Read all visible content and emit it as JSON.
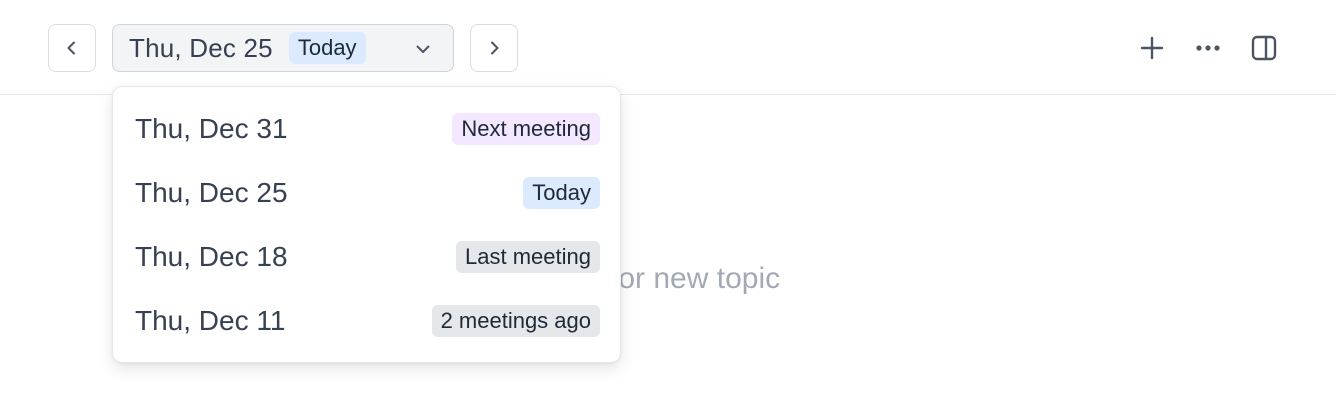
{
  "header": {
    "selected_date": "Thu, Dec 25",
    "selected_badge": "Today",
    "icons": {
      "prev": "chevron-left-icon",
      "next": "chevron-right-icon",
      "dropdown": "chevron-down-icon",
      "add": "plus-icon",
      "more": "more-horizontal-icon",
      "panel": "sidebar-panel-icon"
    }
  },
  "main": {
    "placeholder": "nter” for new topic"
  },
  "dropdown": {
    "items": [
      {
        "label": "Thu, Dec 31",
        "badge": "Next meeting",
        "badge_color": "#f3e8ff"
      },
      {
        "label": "Thu, Dec 25",
        "badge": "Today",
        "badge_color": "#dbeafe"
      },
      {
        "label": "Thu, Dec 18",
        "badge": "Last meeting",
        "badge_color": "#e5e7eb"
      },
      {
        "label": "Thu, Dec 11",
        "badge": "2 meetings ago",
        "badge_color": "#e5e7eb"
      }
    ]
  }
}
